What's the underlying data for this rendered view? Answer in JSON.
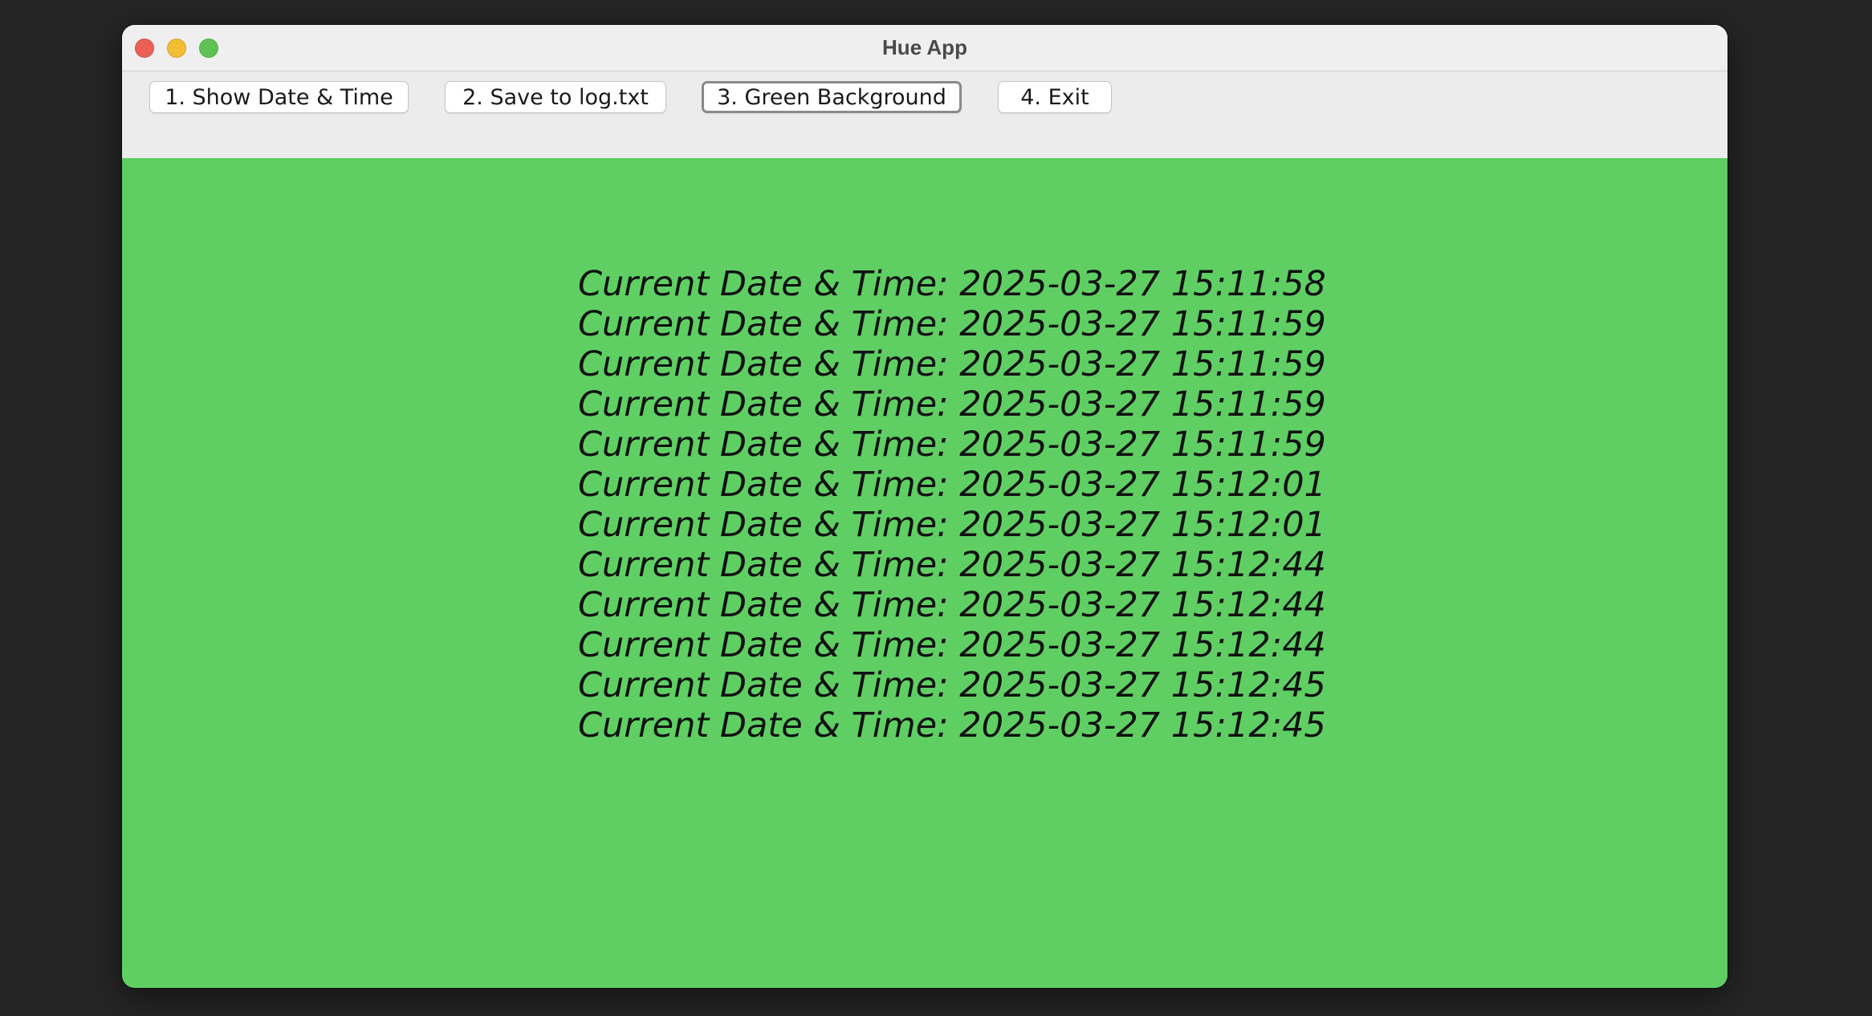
{
  "window": {
    "title": "Hue App",
    "background_color": "#5fcf63"
  },
  "traffic_lights": {
    "close_color": "#ec5f57",
    "minimize_color": "#f2bc33",
    "zoom_color": "#5fc253"
  },
  "toolbar": {
    "buttons": [
      {
        "label": "1. Show Date & Time"
      },
      {
        "label": "2. Save to log.txt"
      },
      {
        "label": "3. Green Background",
        "focused": true
      },
      {
        "label": "4. Exit"
      }
    ]
  },
  "log": {
    "lines": [
      "Current Date & Time: 2025-03-27 15:11:58",
      "Current Date & Time: 2025-03-27 15:11:59",
      "Current Date & Time: 2025-03-27 15:11:59",
      "Current Date & Time: 2025-03-27 15:11:59",
      "Current Date & Time: 2025-03-27 15:11:59",
      "Current Date & Time: 2025-03-27 15:12:01",
      "Current Date & Time: 2025-03-27 15:12:01",
      "Current Date & Time: 2025-03-27 15:12:44",
      "Current Date & Time: 2025-03-27 15:12:44",
      "Current Date & Time: 2025-03-27 15:12:44",
      "Current Date & Time: 2025-03-27 15:12:45",
      "Current Date & Time: 2025-03-27 15:12:45"
    ]
  }
}
